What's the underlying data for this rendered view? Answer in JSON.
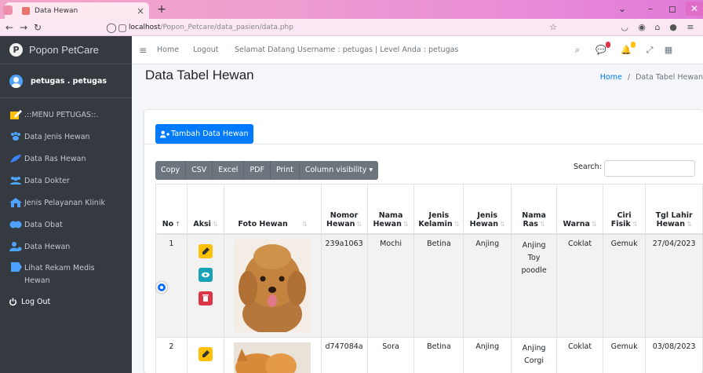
{
  "browser": {
    "tab_title": "Data Hewan",
    "url_host": "localhost",
    "url_path": "/Popon_Petcare/data_pasien/data.php"
  },
  "sidebar": {
    "brand": "Popon PetCare",
    "user": "petugas . petugas",
    "items": [
      {
        "label": ".::MENU PETUGAS::.",
        "icon": "edit-icon"
      },
      {
        "label": "Data Jenis Hewan",
        "icon": "paw-icon"
      },
      {
        "label": "Data Ras Hewan",
        "icon": "feather-icon"
      },
      {
        "label": "Data Dokter",
        "icon": "users-icon"
      },
      {
        "label": "Jenis Pelayanan Klinik",
        "icon": "clinic-icon"
      },
      {
        "label": "Data Obat",
        "icon": "pills-icon"
      },
      {
        "label": "Data Hewan",
        "icon": "user-pet-icon"
      },
      {
        "label": "Lihat Rekam Medis Hewan",
        "icon": "records-icon"
      },
      {
        "label": "Log Out",
        "icon": "power-icon"
      }
    ]
  },
  "navbar": {
    "home": "Home",
    "logout": "Logout",
    "welcome": "Selamat Datang Username : petugas | Level Anda : petugas"
  },
  "page": {
    "title": "Data Tabel Hewan",
    "breadcrumb_home": "Home",
    "breadcrumb_sep": "/",
    "breadcrumb_current": "Data Tabel Hewan"
  },
  "actions": {
    "add_label": "Tambah Data Hewan"
  },
  "datatable": {
    "buttons": [
      "Copy",
      "CSV",
      "Excel",
      "PDF",
      "Print",
      "Column visibility ▾"
    ],
    "search_label": "Search:",
    "search_value": "",
    "columns": [
      "No",
      "Aksi",
      "Foto Hewan",
      "Nomor Hewan",
      "Nama Hewan",
      "Jenis Kelamin",
      "Jenis Hewan",
      "Nama Ras",
      "Warna",
      "Ciri Fisik",
      "Tgl Lahir Hewan"
    ],
    "rows": [
      {
        "no": "1",
        "nomor": "239a1063",
        "nama": "Mochi",
        "kelamin": "Betina",
        "jenis": "Anjing",
        "ras": "Anjing Toy poodle",
        "warna": "Coklat",
        "ciri": "Gemuk",
        "tgl": "27/04/2023"
      },
      {
        "no": "2",
        "nomor": "d747084a",
        "nama": "Sora",
        "kelamin": "Betina",
        "jenis": "Anjing",
        "ras": "Anjing Corgi",
        "warna": "Coklat",
        "ciri": "Gemuk",
        "tgl": "03/08/2023"
      }
    ]
  },
  "colors": {
    "primary": "#007bff",
    "warning": "#ffc107",
    "info": "#17a2b8",
    "danger": "#dc3545",
    "sidebar": "#343a40"
  }
}
